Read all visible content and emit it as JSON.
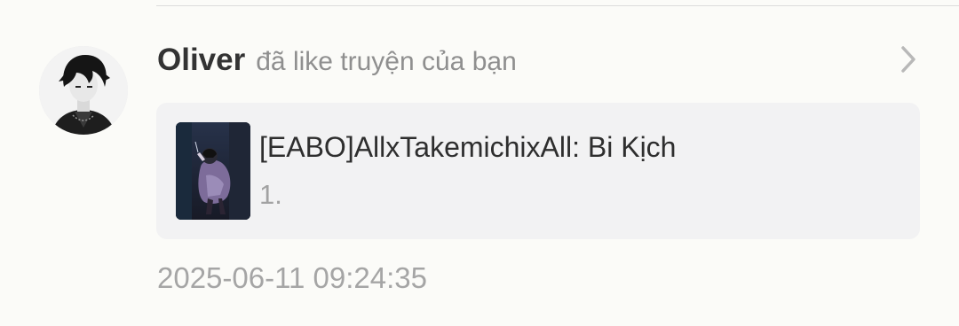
{
  "notification": {
    "username": "Oliver",
    "action_text": "đã like truyện của bạn",
    "avatar_icon": "user-avatar-dark-hair-icon",
    "chevron_icon": "chevron-right-icon",
    "story": {
      "title": "[EABO]AllxTakemichixAll: Bi Kịch",
      "chapter": "1.",
      "cover_icon": "story-cover-image"
    },
    "timestamp": "2025-06-11 09:24:35"
  },
  "colors": {
    "background": "#fbfbf8",
    "card": "#f2f2f3",
    "username": "#333333",
    "secondary_text": "#8f8f8f",
    "chevron": "#b8b8b8"
  }
}
